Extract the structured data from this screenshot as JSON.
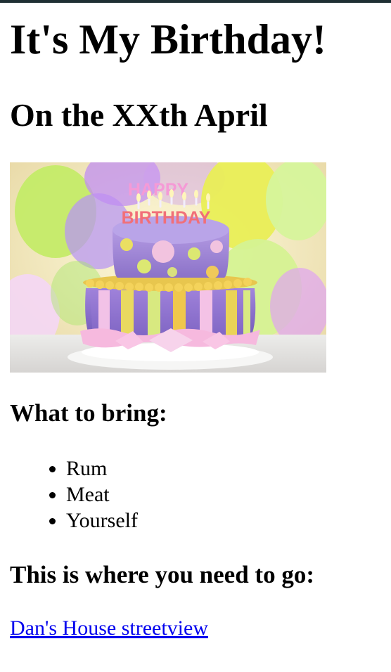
{
  "title": "It's My Birthday!",
  "date": "On the XXth April",
  "image": {
    "banner_line1": "HAPPY",
    "banner_line2": "BIRTHDAY"
  },
  "bring": {
    "heading": "What to bring:",
    "items": [
      "Rum",
      "Meat",
      "Yourself"
    ]
  },
  "location": {
    "heading": "This is where you need to go:",
    "link": "Dan's House streetview"
  },
  "colors": {
    "top_bar": "#1f2f33",
    "link": "#0000ee"
  }
}
